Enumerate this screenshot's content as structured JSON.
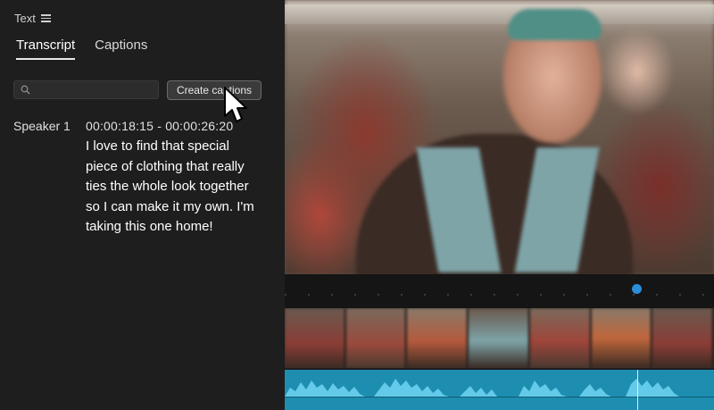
{
  "panel": {
    "title": "Text",
    "tabs": [
      {
        "label": "Transcript",
        "active": true
      },
      {
        "label": "Captions",
        "active": false
      }
    ],
    "search": {
      "placeholder": "",
      "value": ""
    },
    "create_button_label": "Create captions"
  },
  "transcript": {
    "speaker": "Speaker 1",
    "timecode": "00:00:18:15 - 00:00:26:20",
    "text": "I love to find that special piece of clothing that really ties the whole look together so I can make it my own. I'm taking this one home!"
  },
  "icons": {
    "panel_menu": "hamburger-menu-icon",
    "search": "search-icon",
    "cursor": "mouse-pointer-icon"
  },
  "colors": {
    "panel_bg": "#1e1e1e",
    "playhead": "#2a8ed8",
    "audio_waveform": "#1e8eb0"
  }
}
